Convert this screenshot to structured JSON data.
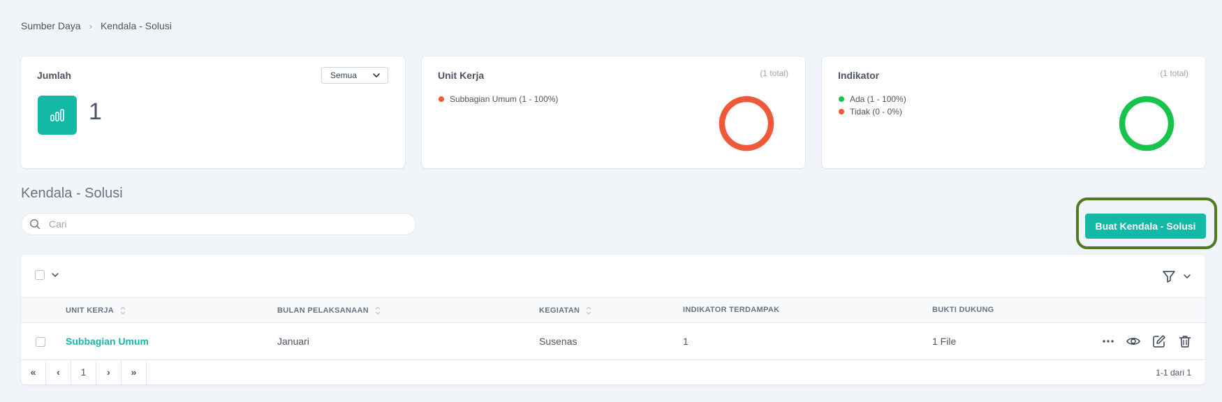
{
  "breadcrumb": {
    "items": [
      "Sumber Daya",
      "Kendala - Solusi"
    ],
    "separator": "›"
  },
  "cards": {
    "jumlah": {
      "title": "Jumlah",
      "select_value": "Semua",
      "value": "1",
      "icon": "bar-chart-icon"
    },
    "unit_kerja": {
      "title": "Unit Kerja",
      "total": "(1 total)",
      "legend": [
        {
          "label": "Subbagian Umum (1 - 100%)",
          "color": "#f0583a"
        }
      ],
      "donut_color": "#f0583a"
    },
    "indikator": {
      "title": "Indikator",
      "total": "(1 total)",
      "legend": [
        {
          "label": "Ada (1 - 100%)",
          "color": "#18c34c"
        },
        {
          "label": "Tidak (0 - 0%)",
          "color": "#f0583a"
        }
      ],
      "donut_color": "#18c34c"
    }
  },
  "section": {
    "title": "Kendala - Solusi"
  },
  "search": {
    "placeholder": "Cari",
    "value": ""
  },
  "create_button": {
    "label": "Buat Kendala - Solusi"
  },
  "table": {
    "columns": [
      "UNIT KERJA",
      "BULAN PELAKSANAAN",
      "KEGIATAN",
      "INDIKATOR TERDAMPAK",
      "BUKTI DUKUNG"
    ],
    "rows": [
      {
        "unit_kerja": "Subbagian Umum",
        "bulan": "Januari",
        "kegiatan": "Susenas",
        "indikator": "1",
        "bukti": "1 File"
      }
    ]
  },
  "pagination": {
    "first": "«",
    "prev": "‹",
    "current": "1",
    "next": "›",
    "last": "»",
    "range": "1-1 dari 1"
  },
  "colors": {
    "accent": "#14b8a6",
    "highlight": "#4d7b1f",
    "background": "#f1f4f8"
  }
}
